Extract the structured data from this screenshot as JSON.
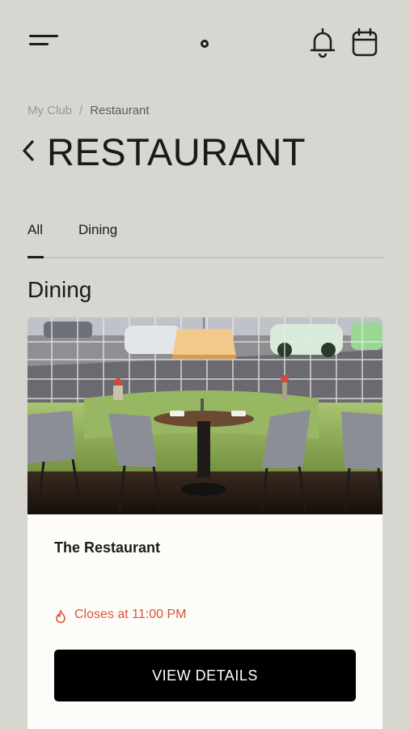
{
  "header": {
    "menu_icon": "hamburger-menu-icon",
    "logo_icon": "logo-dot",
    "notifications_icon": "bell-icon",
    "calendar_icon": "calendar-icon"
  },
  "breadcrumb": {
    "items": [
      "My Club",
      "Restaurant"
    ],
    "separator": "/"
  },
  "page": {
    "back_icon": "chevron-left-icon",
    "title": "RESTAURANT"
  },
  "tabs": [
    {
      "label": "All",
      "active": true
    },
    {
      "label": "Dining",
      "active": false
    }
  ],
  "section": {
    "title": "Dining"
  },
  "card": {
    "image_description": "restaurant-interior-photo",
    "name": "The Restaurant",
    "hours_icon": "flame-icon",
    "hours_text": "Closes at 11:00 PM",
    "button_label": "VIEW DETAILS"
  },
  "colors": {
    "background": "#d7d6d1",
    "card_background": "#fdfcf8",
    "hours_accent": "#d9573b",
    "button_background": "#000000",
    "button_text": "#ffffff"
  }
}
